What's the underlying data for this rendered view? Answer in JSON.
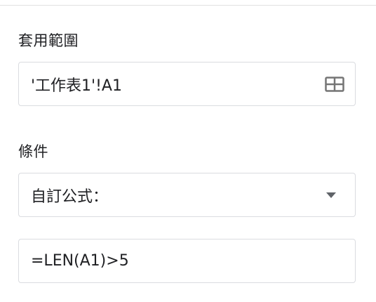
{
  "range_section": {
    "label": "套用範圍",
    "value": "'工作表1'!A1",
    "icon": "grid-icon"
  },
  "condition_section": {
    "label": "條件",
    "selected_option": "自訂公式：",
    "icon": "caret-down-icon"
  },
  "formula": {
    "value": "=LEN(A1)>5"
  },
  "colors": {
    "border": "#dadce0",
    "text": "#202124",
    "icon": "#757575"
  }
}
